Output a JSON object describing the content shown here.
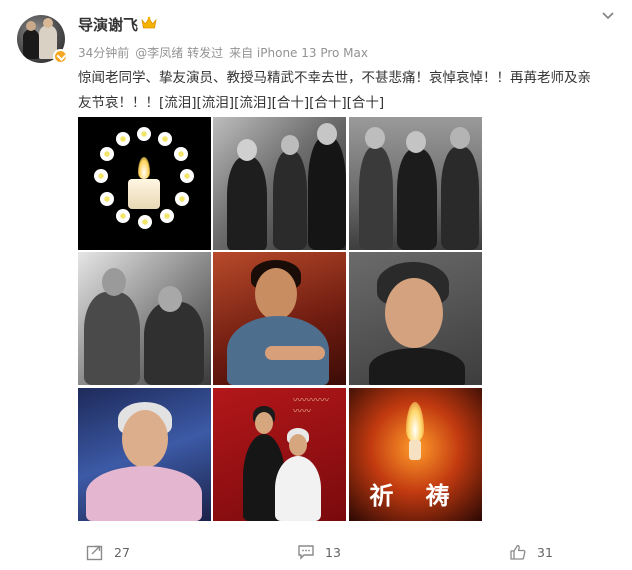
{
  "post": {
    "author": "导演谢飞",
    "time": "34分钟前",
    "repost_from": "@李凤绪 转发过",
    "source": "来自 iPhone 13 Pro Max",
    "text_line1": "惊闻老同学、挚友演员、教授马精武不幸去世，不甚悲痛！哀悼哀悼！！再苒老师及亲",
    "text_line2": "友节哀！！！[流泪][流泪][流泪][合十][合十][合十]",
    "image_caption": "祈 祷"
  },
  "actions": {
    "repost_count": "27",
    "comment_count": "13",
    "like_count": "31"
  },
  "icons": {
    "menu": "chevron-down-icon",
    "badge": "crown-icon",
    "verified": "verified-badge-icon",
    "repost": "repost-icon",
    "comment": "comment-icon",
    "like": "thumb-up-icon"
  },
  "colors": {
    "verified": "#f5a623",
    "text": "#333333",
    "meta": "#939393"
  }
}
